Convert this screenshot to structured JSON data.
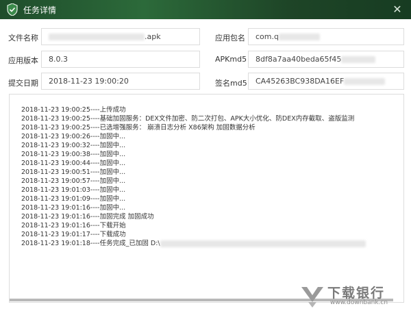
{
  "window": {
    "title": "任务详情",
    "close_glyph": "✕"
  },
  "fields": {
    "file_name": {
      "label": "文件名称",
      "value": ".apk"
    },
    "package_name": {
      "label": "应用包名",
      "value": "com.q"
    },
    "version": {
      "label": "应用版本",
      "value": "8.0.3"
    },
    "apk_md5": {
      "label": "APKmd5",
      "value": "8df8a7aa40beda65f45"
    },
    "submit_date": {
      "label": "提交日期",
      "value": "2018-11-23 19:00:20"
    },
    "signature_md5": {
      "label": "签名md5",
      "value": "CA45263BC938DA16EF"
    }
  },
  "log": [
    "2018-11-23 19:00:25----上传成功",
    "2018-11-23 19:00:25----基础加固服务：DEX文件加密、防二次打包、APK大小优化、防DEX内存截取、盗版监测",
    "2018-11-23 19:00:25----已选增强服务：  崩溃日志分析  X86架构  加固数据分析",
    "2018-11-23 19:00:26----加固中...",
    "2018-11-23 19:00:32----加固中...",
    "2018-11-23 19:00:38----加固中...",
    "2018-11-23 19:00:44----加固中...",
    "2018-11-23 19:00:51----加固中...",
    "2018-11-23 19:00:57----加固中...",
    "2018-11-23 19:01:03----加固中...",
    "2018-11-23 19:01:09----加固中...",
    "2018-11-23 19:01:16----加固中...",
    "2018-11-23 19:01:16----加固完成 加固成功",
    "2018-11-23 19:01:16----下载开始",
    "2018-11-23 19:01:17----下载成功",
    "2018-11-23 19:01:18----任务完成_已加固 D:\\"
  ],
  "watermark": {
    "name": "下载银行",
    "url": "www.downbank.cn"
  },
  "colors": {
    "titlebar": "#2c6a3a",
    "shield": "#3a8a4a",
    "border": "#dcdcdc"
  }
}
